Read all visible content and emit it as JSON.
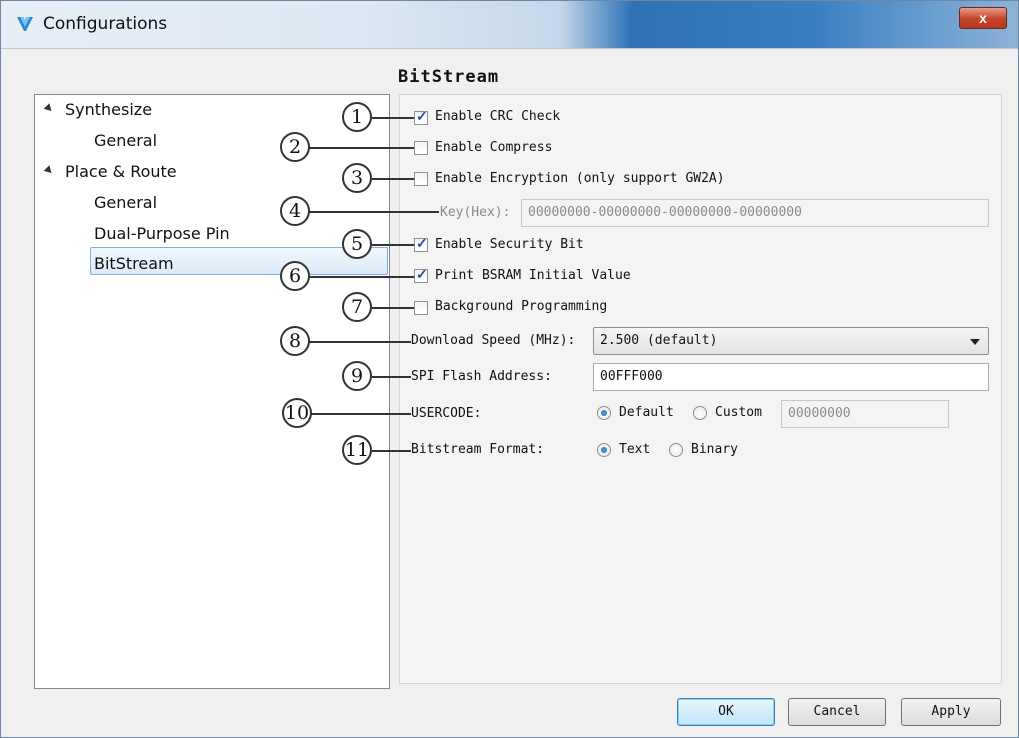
{
  "window": {
    "title": "Configurations",
    "close_symbol": "x",
    "colors": {
      "accent": "#3a7fc2",
      "close": "#c4432a",
      "selection": "#dbeaf9"
    }
  },
  "section_heading": "BitStream",
  "tree": {
    "items": [
      {
        "label": "Synthesize",
        "level": 0,
        "expanded": true
      },
      {
        "label": "General",
        "level": 1
      },
      {
        "label": "Place & Route",
        "level": 0,
        "expanded": true
      },
      {
        "label": "General",
        "level": 1
      },
      {
        "label": "Dual-Purpose Pin",
        "level": 1
      },
      {
        "label": "BitStream",
        "level": 1,
        "selected": true
      }
    ]
  },
  "options": {
    "crc": {
      "label": "Enable CRC Check",
      "checked": true
    },
    "compress": {
      "label": "Enable Compress",
      "checked": false
    },
    "encryption": {
      "label": "Enable Encryption (only support GW2A)",
      "checked": false
    },
    "key": {
      "label": "Key(Hex):",
      "value": "00000000-00000000-00000000-00000000",
      "disabled": true
    },
    "security": {
      "label": "Enable Security Bit",
      "checked": true
    },
    "bsram": {
      "label": "Print BSRAM Initial Value",
      "checked": true
    },
    "background": {
      "label": "Background Programming",
      "checked": false
    },
    "download_speed": {
      "label": "Download Speed (MHz):",
      "value": "2.500 (default)"
    },
    "spi_flash": {
      "label": "SPI Flash Address:",
      "value": "00FFF000"
    },
    "usercode": {
      "label": "USERCODE:",
      "choices": [
        "Default",
        "Custom"
      ],
      "selected": "Default",
      "custom_value": "00000000"
    },
    "bitstream_format": {
      "label": "Bitstream Format:",
      "choices": [
        "Text",
        "Binary"
      ],
      "selected": "Text"
    }
  },
  "callouts": [
    "1",
    "2",
    "3",
    "4",
    "5",
    "6",
    "7",
    "8",
    "9",
    "10",
    "11"
  ],
  "buttons": {
    "ok": "OK",
    "cancel": "Cancel",
    "apply": "Apply"
  }
}
